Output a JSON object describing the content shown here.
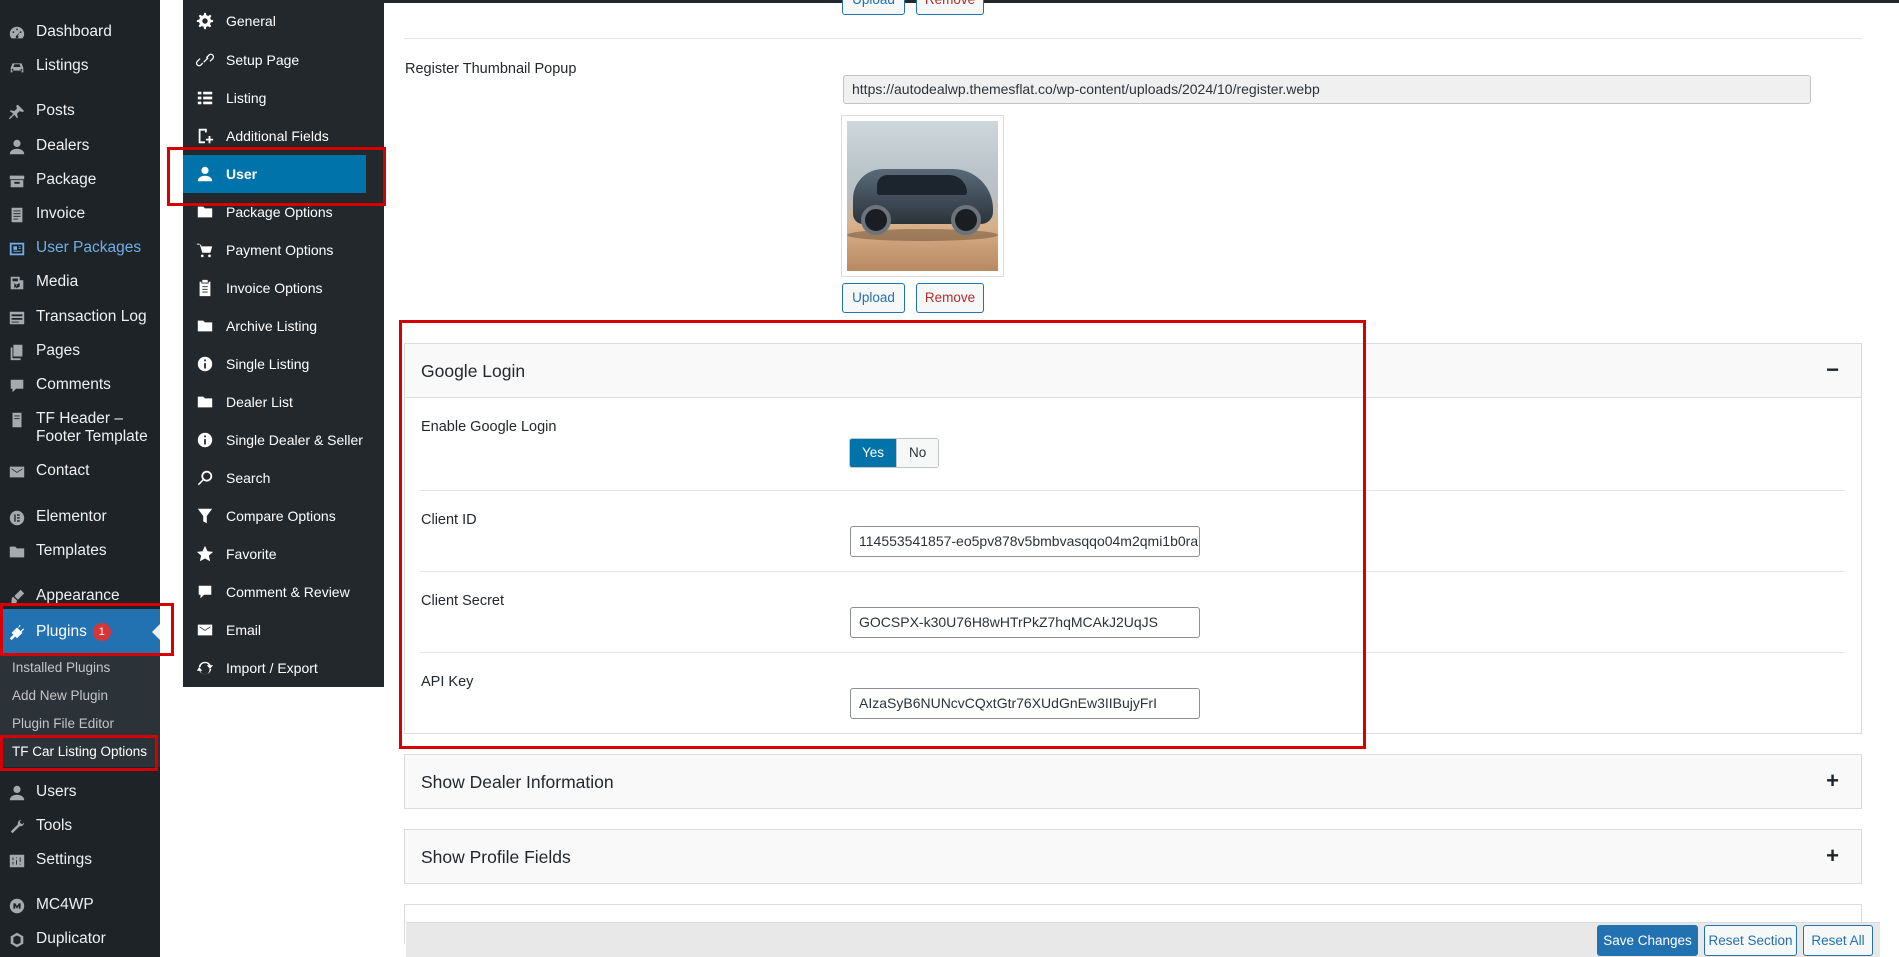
{
  "wp_menu": {
    "items": [
      {
        "label": "Dashboard",
        "icon": "dashboard-icon"
      },
      {
        "label": "Listings",
        "icon": "listings-icon"
      },
      {
        "label": "Posts",
        "icon": "pin-icon"
      },
      {
        "label": "Dealers",
        "icon": "user-icon"
      },
      {
        "label": "Package",
        "icon": "package-icon"
      },
      {
        "label": "Invoice",
        "icon": "invoice-icon"
      },
      {
        "label": "User Packages",
        "icon": "id-card-icon"
      },
      {
        "label": "Media",
        "icon": "media-icon"
      },
      {
        "label": "Transaction Log",
        "icon": "log-icon"
      },
      {
        "label": "Pages",
        "icon": "pages-icon"
      },
      {
        "label": "Comments",
        "icon": "comment-icon"
      },
      {
        "label": "TF Header –",
        "label2": "Footer Template",
        "icon": "template-icon"
      },
      {
        "label": "Contact",
        "icon": "mail-icon"
      },
      {
        "label": "Elementor",
        "icon": "elementor-icon"
      },
      {
        "label": "Templates",
        "icon": "folder-icon"
      },
      {
        "label": "Appearance",
        "icon": "brush-icon"
      },
      {
        "label": "Plugins",
        "icon": "plug-icon",
        "badge": "1"
      },
      {
        "label": "Users",
        "icon": "users-icon"
      },
      {
        "label": "Tools",
        "icon": "wrench-icon"
      },
      {
        "label": "Settings",
        "icon": "settings-icon"
      },
      {
        "label": "MC4WP",
        "icon": "mc4wp-icon"
      },
      {
        "label": "Duplicator",
        "icon": "duplicator-icon"
      }
    ],
    "plugins_submenu": [
      "Installed Plugins",
      "Add New Plugin",
      "Plugin File Editor",
      "TF Car Listing Options"
    ]
  },
  "options_menu": {
    "items": [
      {
        "label": "General",
        "icon": "gear-icon"
      },
      {
        "label": "Setup Page",
        "icon": "link-icon"
      },
      {
        "label": "Listing",
        "icon": "list-icon"
      },
      {
        "label": "Additional Fields",
        "icon": "add-field-icon"
      },
      {
        "label": "User",
        "icon": "user-icon"
      },
      {
        "label": "Package Options",
        "icon": "folder-icon"
      },
      {
        "label": "Payment Options",
        "icon": "cart-icon"
      },
      {
        "label": "Invoice Options",
        "icon": "clipboard-icon"
      },
      {
        "label": "Archive Listing",
        "icon": "folder-icon"
      },
      {
        "label": "Single Listing",
        "icon": "info-icon"
      },
      {
        "label": "Dealer List",
        "icon": "folder-icon"
      },
      {
        "label": "Single Dealer & Seller",
        "icon": "info-icon"
      },
      {
        "label": "Search",
        "icon": "search-icon"
      },
      {
        "label": "Compare Options",
        "icon": "filter-icon"
      },
      {
        "label": "Favorite",
        "icon": "star-icon"
      },
      {
        "label": "Comment & Review",
        "icon": "comment-icon"
      },
      {
        "label": "Email",
        "icon": "mail-icon"
      },
      {
        "label": "Import / Export",
        "icon": "refresh-icon"
      }
    ]
  },
  "content": {
    "upload_label": "Upload",
    "remove_label": "Remove",
    "thumbnail": {
      "label": "Register Thumbnail Popup",
      "url": "https://autodealwp.themesflat.co/wp-content/uploads/2024/10/register.webp"
    },
    "google_login": {
      "title": "Google Login",
      "toggle": "−",
      "enable_label": "Enable Google Login",
      "yes": "Yes",
      "no": "No",
      "client_id_label": "Client ID",
      "client_id_value": "114553541857-eo5pv878v5bmbvasqqo04m2qmi1b0ra",
      "client_secret_label": "Client Secret",
      "client_secret_value": "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",
      "api_key_label": "API Key",
      "api_key_value": "AIzaSyB6NUNcvCQxtGtr76XUdGnEw3IIBujyFrI"
    },
    "dealer_info": {
      "title": "Show Dealer Information",
      "toggle": "+"
    },
    "profile_fields": {
      "title": "Show Profile Fields",
      "toggle": "+"
    }
  },
  "footer": {
    "save": "Save Changes",
    "reset_section": "Reset Section",
    "reset_all": "Reset All"
  },
  "colors": {
    "accent": "#2271b1",
    "highlight_box": "#d60000",
    "sidebar_bg": "#1d2327"
  }
}
